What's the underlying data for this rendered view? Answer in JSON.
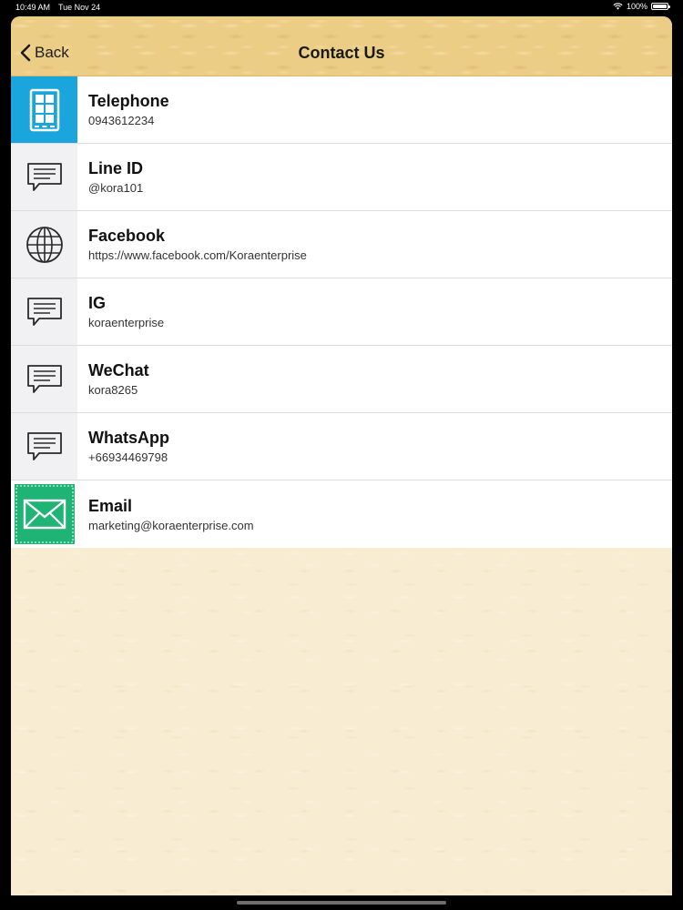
{
  "status_bar": {
    "time": "10:49 AM",
    "date": "Tue Nov 24",
    "battery": "100%"
  },
  "nav": {
    "back_label": "Back",
    "title": "Contact Us"
  },
  "contacts": [
    {
      "title": "Telephone",
      "value": "0943612234",
      "icon": "phone-icon",
      "icon_color": "#1aa6dc"
    },
    {
      "title": "Line ID",
      "value": "@kora101",
      "icon": "chat-icon"
    },
    {
      "title": "Facebook",
      "value": "https://www.facebook.com/Koraenterprise",
      "icon": "globe-icon"
    },
    {
      "title": "IG",
      "value": "koraenterprise",
      "icon": "chat-icon"
    },
    {
      "title": "WeChat",
      "value": "kora8265",
      "icon": "chat-icon"
    },
    {
      "title": "WhatsApp",
      "value": "+66934469798",
      "icon": "chat-icon"
    },
    {
      "title": "Email",
      "value": "marketing@koraenterprise.com",
      "icon": "mail-icon",
      "icon_color": "#1fb476"
    }
  ]
}
